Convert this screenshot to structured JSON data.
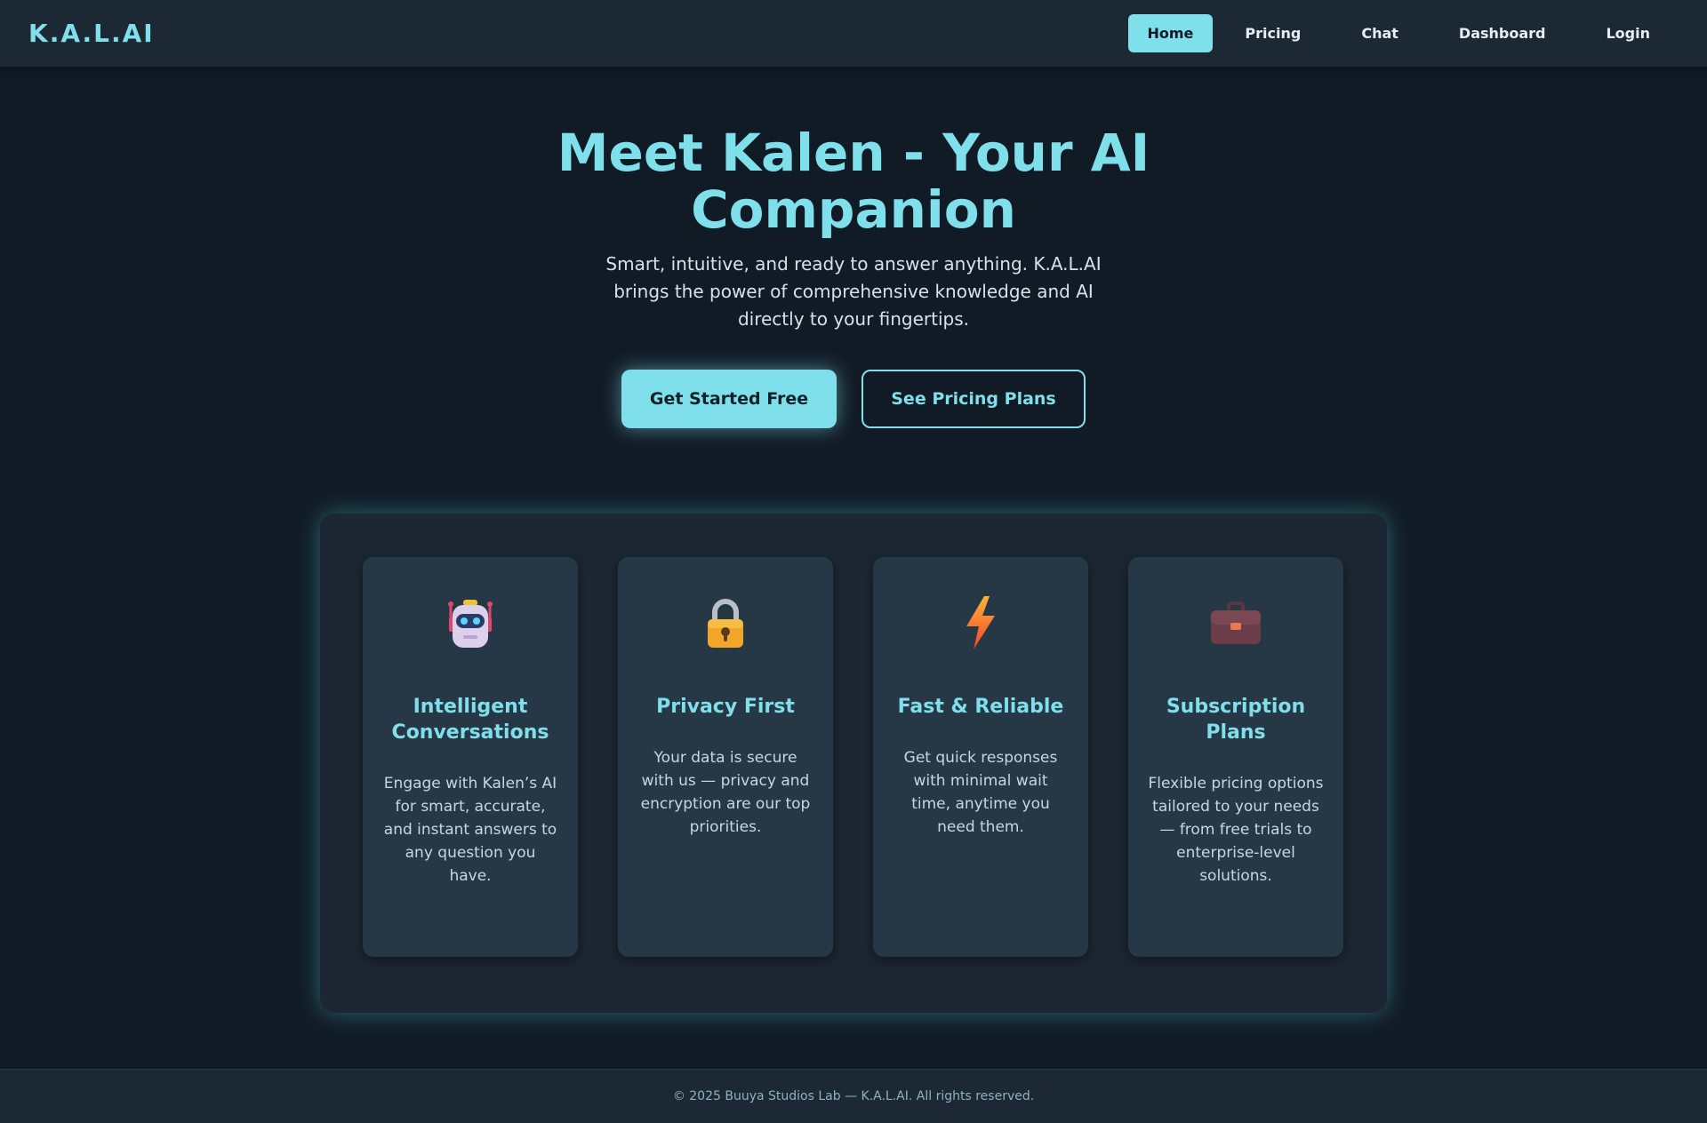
{
  "brand": "K.A.L.AI",
  "nav": {
    "items": [
      "Home",
      "Pricing",
      "Chat",
      "Dashboard",
      "Login"
    ],
    "active": "Home"
  },
  "hero": {
    "title": "Meet Kalen - Your AI Companion",
    "subtitle": "Smart, intuitive, and ready to answer anything. K.A.L.AI brings the power of comprehensive knowledge and AI directly to your fingertips.",
    "primary_cta": "Get Started Free",
    "secondary_cta": "See Pricing Plans"
  },
  "features": [
    {
      "icon": "robot-icon",
      "title": "Intelligent Conversations",
      "description": "Engage with Kalen’s AI for smart, accurate, and instant answers to any question you have."
    },
    {
      "icon": "lock-icon",
      "title": "Privacy First",
      "description": "Your data is secure with us — privacy and encryption are our top priorities."
    },
    {
      "icon": "lightning-icon",
      "title": "Fast & Reliable",
      "description": "Get quick responses with minimal wait time, anytime you need them."
    },
    {
      "icon": "briefcase-icon",
      "title": "Subscription Plans",
      "description": "Flexible pricing options tailored to your needs — from free trials to enterprise-level solutions."
    }
  ],
  "footer": {
    "text": "© 2025 Buuya Studios Lab — K.A.L.AI. All rights reserved."
  },
  "colors": {
    "accent": "#7fdfea",
    "background": "#111b25",
    "navbar": "#1c2834",
    "card": "#263845"
  }
}
